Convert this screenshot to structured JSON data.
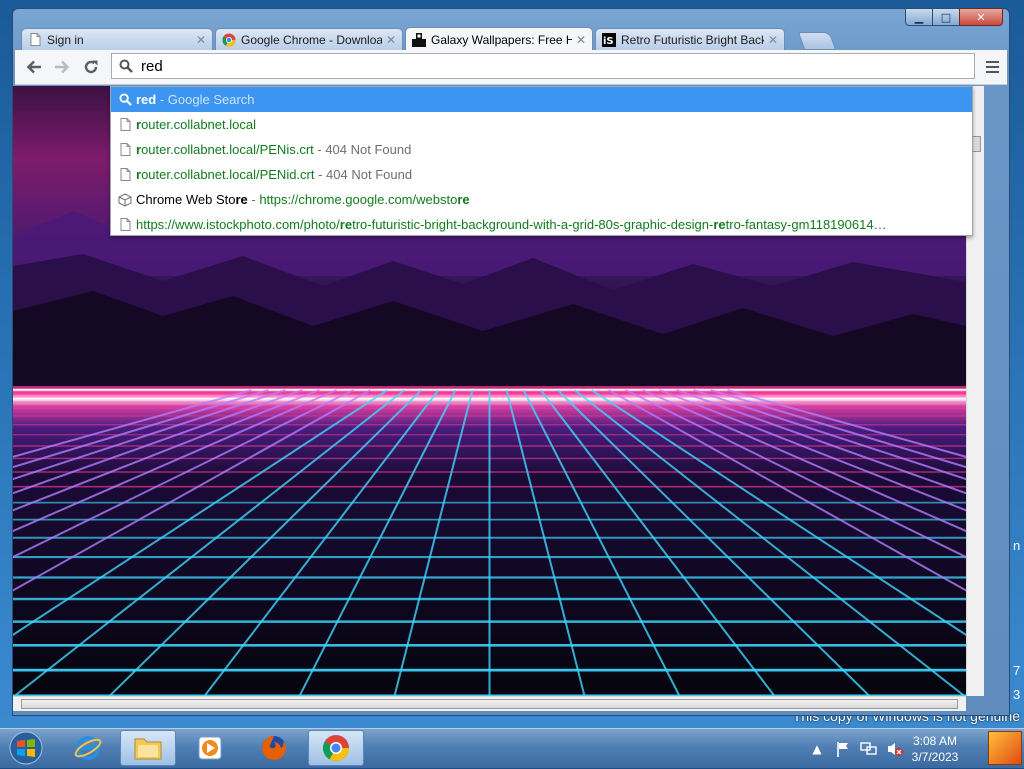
{
  "browser": {
    "tabs": [
      {
        "title": "Sign in",
        "active": false
      },
      {
        "title": "Google Chrome - Downloa",
        "active": false
      },
      {
        "title": "Galaxy Wallpapers: Free HD",
        "active": true
      },
      {
        "title": "Retro Futuristic Bright Back",
        "active": false
      }
    ],
    "omnibox": {
      "value": "red"
    },
    "window_controls": {
      "minimize": "▁",
      "maximize": "□",
      "close": "✕"
    },
    "icons": {
      "back": "arrow-left-icon",
      "forward": "arrow-right-icon",
      "reload": "reload-icon",
      "menu": "hamburger-menu-icon"
    }
  },
  "suggestions": [
    {
      "kind": "search",
      "parts": [
        {
          "t": "red",
          "c": "b"
        },
        {
          "t": " - Google Search",
          "c": "gray"
        }
      ]
    },
    {
      "kind": "page",
      "parts": [
        {
          "t": "r",
          "c": "g b"
        },
        {
          "t": "outer.collabnet.local",
          "c": "g"
        }
      ]
    },
    {
      "kind": "page",
      "parts": [
        {
          "t": "r",
          "c": "g b"
        },
        {
          "t": "outer.collabnet.local/PENis.crt",
          "c": "g"
        },
        {
          "t": " - 404 Not Found",
          "c": "gray"
        }
      ]
    },
    {
      "kind": "page",
      "parts": [
        {
          "t": "r",
          "c": "g b"
        },
        {
          "t": "outer.collabnet.local/PENid.crt",
          "c": "g"
        },
        {
          "t": " - 404 Not Found",
          "c": "gray"
        }
      ]
    },
    {
      "kind": "store",
      "parts": [
        {
          "t": "Chrome Web Sto",
          "c": ""
        },
        {
          "t": "re",
          "c": "b"
        },
        {
          "t": " - ",
          "c": "gray"
        },
        {
          "t": "https://chrome.google.com/websto",
          "c": "g"
        },
        {
          "t": "re",
          "c": "g b"
        }
      ]
    },
    {
      "kind": "page",
      "parts": [
        {
          "t": "https://www.istockphoto.com/photo/",
          "c": "g"
        },
        {
          "t": "re",
          "c": "g b"
        },
        {
          "t": "tro-futuristic-bright-background-with-a-grid-80s-graphic-design-",
          "c": "g"
        },
        {
          "t": "re",
          "c": "g b"
        },
        {
          "t": "tro-fantasy-gm118190614…",
          "c": "g"
        }
      ]
    }
  ],
  "desktop": {
    "watermark": "This copy of Windows is not genuine",
    "edge_fragments": [
      "n",
      "7",
      "3"
    ]
  },
  "taskbar": {
    "clock_time": "3:08 AM",
    "clock_date": "3/7/2023",
    "apps": [
      "internet-explorer-icon",
      "file-explorer-icon",
      "media-player-icon",
      "firefox-icon",
      "chrome-icon"
    ]
  },
  "colors": {
    "selection": "#3d95f2",
    "url_green": "#117c1d",
    "neon_pink": "#ff3e9e",
    "grid_cyan": "#3fd7ff"
  }
}
